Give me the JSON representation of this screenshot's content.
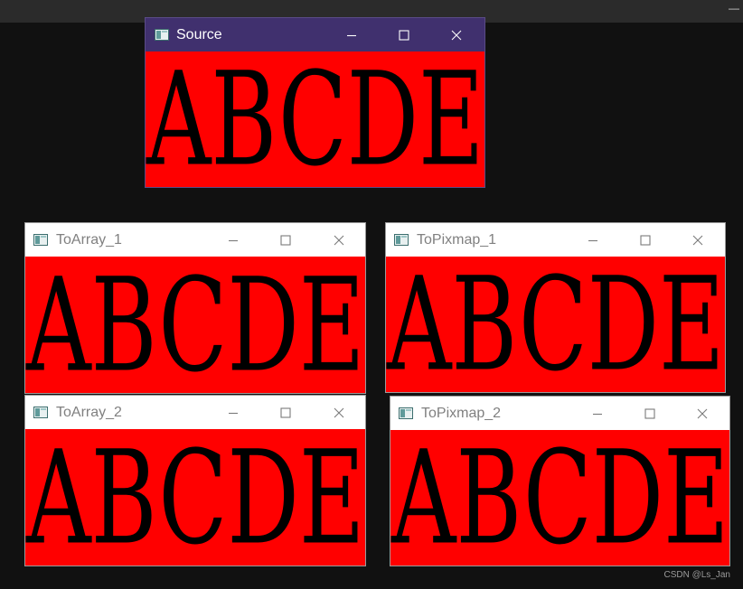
{
  "desktop": {
    "background": "#111111",
    "topbar_background": "#2b2b2b",
    "topbar_min": "—"
  },
  "windows": [
    {
      "key": "source",
      "title": "Source",
      "content": "ABCDE",
      "active": true
    },
    {
      "key": "toarray1",
      "title": "ToArray_1",
      "content": "ABCDE",
      "active": false
    },
    {
      "key": "topixmap1",
      "title": "ToPixmap_1",
      "content": "ABCDE",
      "active": false
    },
    {
      "key": "toarray2",
      "title": "ToArray_2",
      "content": "ABCDE",
      "active": false
    },
    {
      "key": "topixmap2",
      "title": "ToPixmap_2",
      "content": "ABCDE",
      "active": false
    }
  ],
  "colors": {
    "content_background": "#ff0000",
    "content_text": "#000000",
    "active_titlebar": "#40306e",
    "inactive_titlebar": "#ffffff"
  },
  "icons": {
    "app": "app-icon",
    "minimize": "minimize-icon",
    "maximize": "maximize-icon",
    "close": "close-icon"
  },
  "watermark": "CSDN @Ls_Jan"
}
